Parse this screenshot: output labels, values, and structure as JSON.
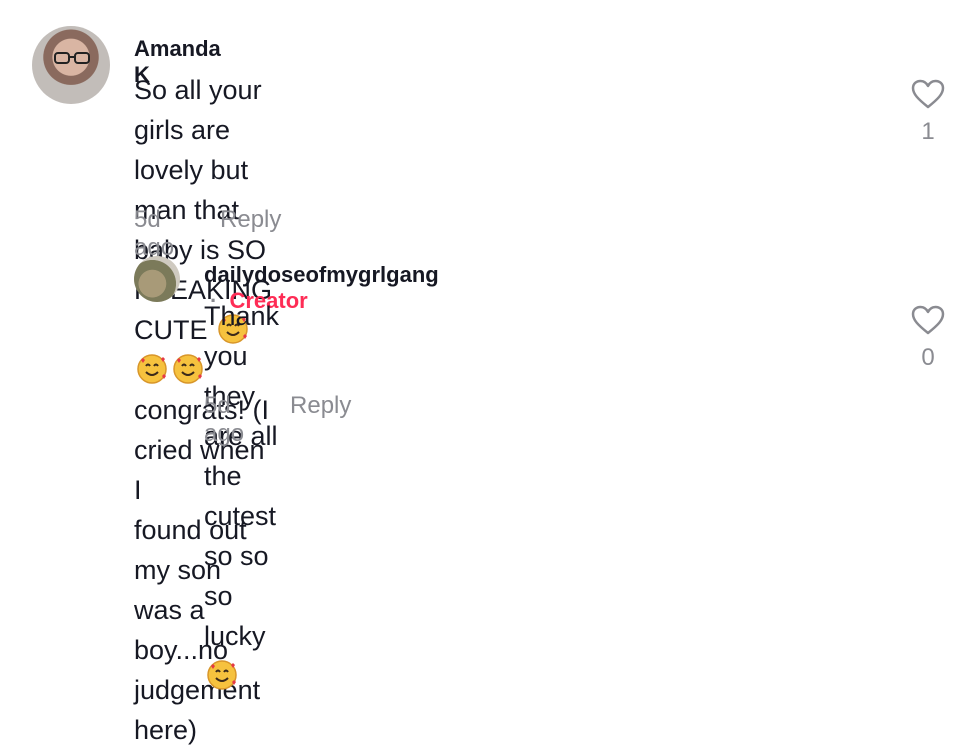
{
  "comments": {
    "main": {
      "author": "Amanda K",
      "line1": "So all your girls are lovely but man that baby is SO",
      "line2_pre": "FREAKING CUTE",
      "line2_post": "congrats! (I cried when I",
      "line3": "found out my son was a boy...no judgement here)",
      "emoji_icon": "smiling-face-with-hearts-emoji",
      "time": "5d ago",
      "reply_label": "Reply",
      "like_count": "1"
    },
    "reply": {
      "author": "dailydoseofmygrlgang",
      "separator": "·",
      "badge": "Creator",
      "line1": "Thank you they are all the cutest so so so",
      "line2": "lucky",
      "emoji_icon": "smiling-face-with-hearts-emoji",
      "time": "5d ago",
      "reply_label": "Reply",
      "like_count": "0"
    }
  },
  "colors": {
    "text": "#161823",
    "muted": "#8a8b91",
    "creator": "#fe2c55"
  }
}
